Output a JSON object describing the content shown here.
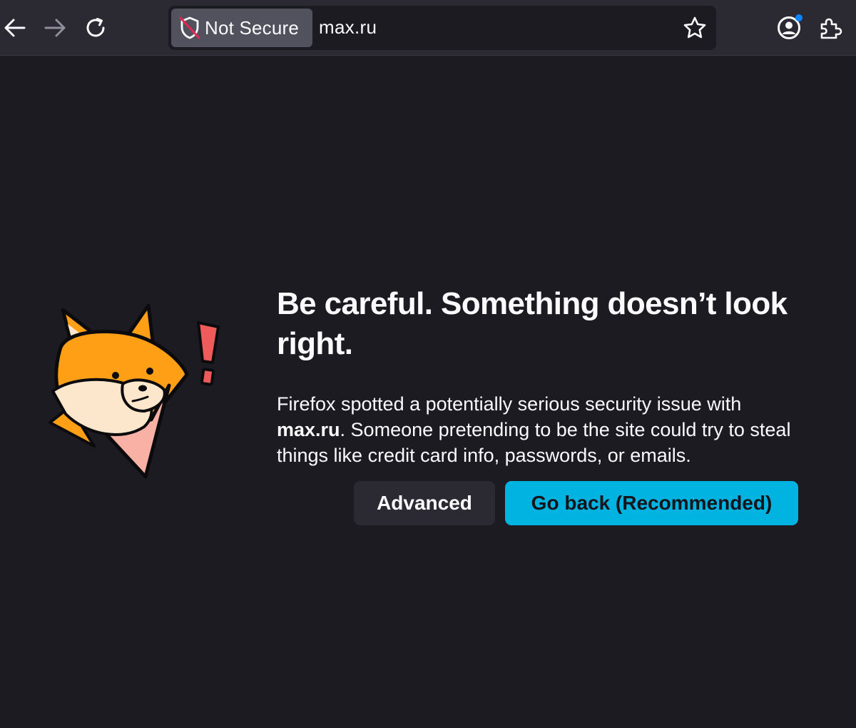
{
  "toolbar": {
    "back_icon": "arrow-left-icon",
    "forward_icon": "arrow-right-icon",
    "reload_icon": "reload-icon",
    "account_icon": "account-icon",
    "extensions_icon": "puzzle-icon",
    "notification_dot_color": "#0a84ff"
  },
  "urlbar": {
    "identity_icon": "shield-slash-icon",
    "identity_label": "Not Secure",
    "identity_slash_color": "#e22850",
    "url": "max.ru",
    "bookmark_icon": "star-icon"
  },
  "error_page": {
    "illustration": "fox-alert-illustration",
    "title": "Be careful. Something doesn’t look right.",
    "description_prefix": "Firefox spotted a potentially serious security issue with ",
    "description_host": "max.ru",
    "description_suffix": ". Someone pretending to be the site could try to steal things like credit card info, passwords, or emails.",
    "advanced_label": "Advanced",
    "go_back_label": "Go back (Recommended)"
  },
  "colors": {
    "page_background": "#1c1b22",
    "toolbar_background": "#2b2a33",
    "primary_button": "#00b3e0",
    "fox_orange": "#ff9f16",
    "alert_red": "#ef5b5b"
  }
}
